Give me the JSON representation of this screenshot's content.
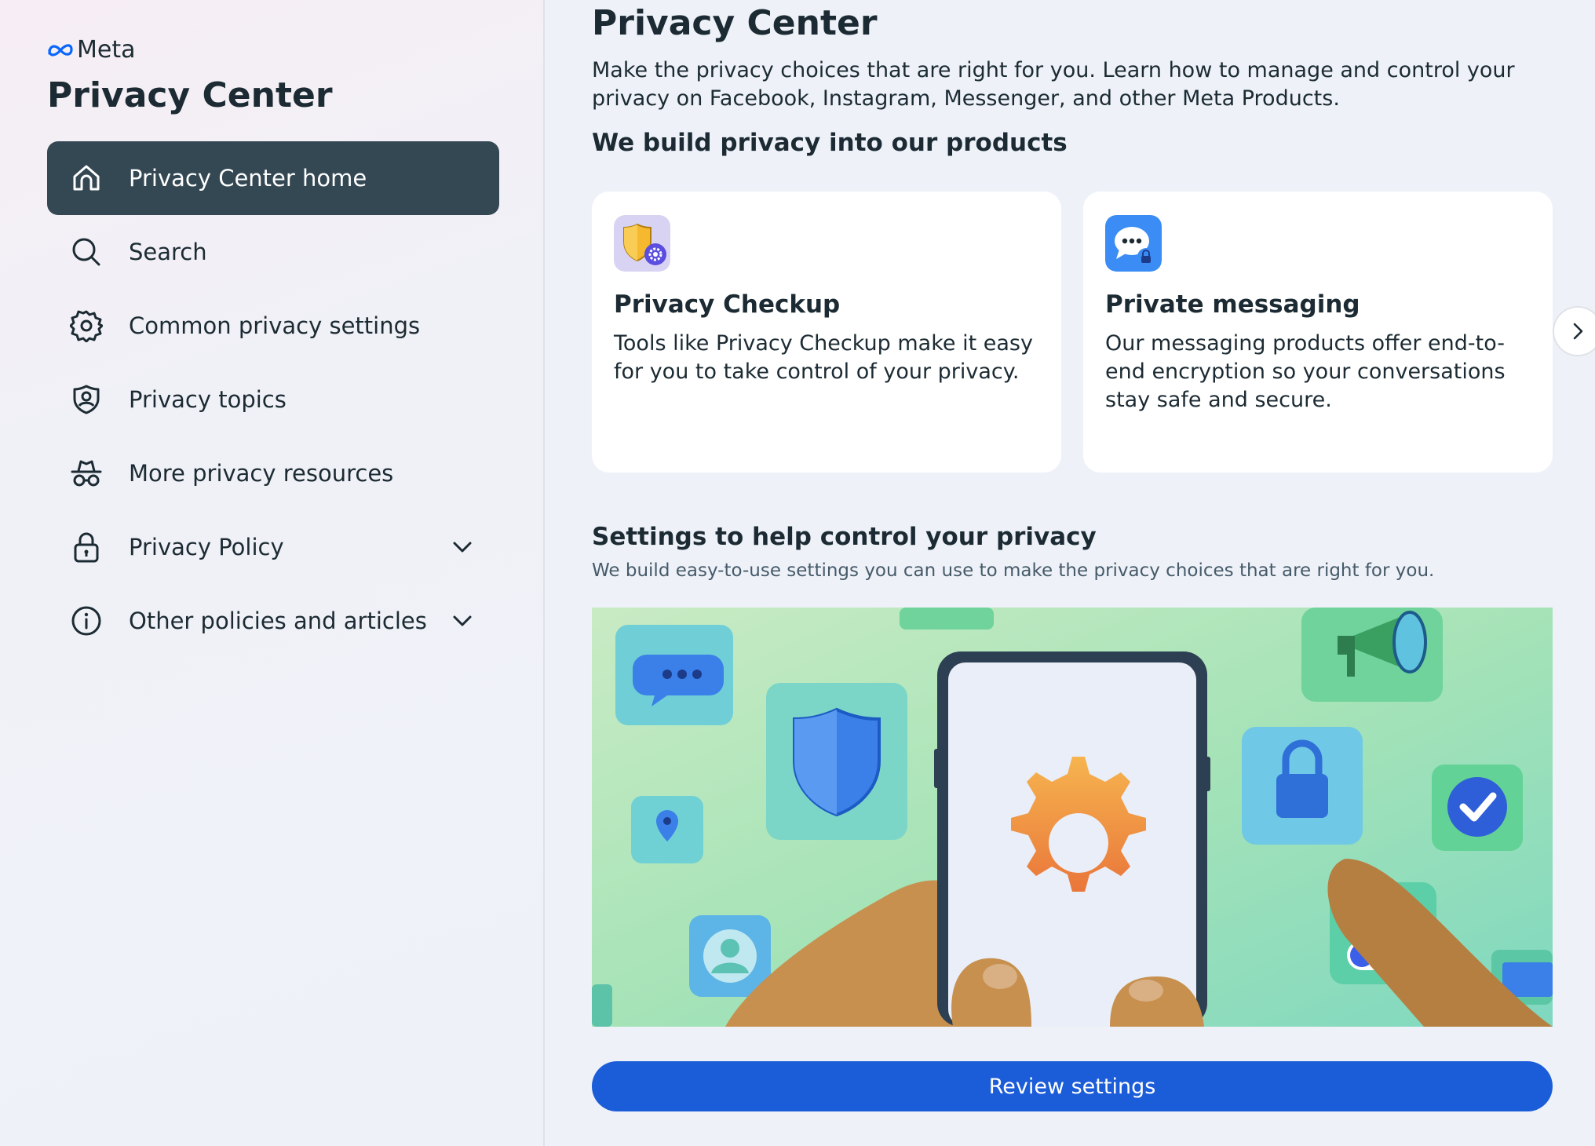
{
  "sidebar": {
    "brand": "Meta",
    "title": "Privacy Center",
    "items": [
      {
        "label": "Privacy Center home",
        "icon": "home-icon",
        "active": true
      },
      {
        "label": "Search",
        "icon": "search-icon"
      },
      {
        "label": "Common privacy settings",
        "icon": "gear-icon"
      },
      {
        "label": "Privacy topics",
        "icon": "shield-user-icon"
      },
      {
        "label": "More privacy resources",
        "icon": "incognito-icon"
      },
      {
        "label": "Privacy Policy",
        "icon": "lock-icon",
        "expandable": true
      },
      {
        "label": "Other policies and articles",
        "icon": "info-icon",
        "expandable": true
      }
    ]
  },
  "main": {
    "title": "Privacy Center",
    "intro": "Make the privacy choices that are right for you. Learn how to manage and control your privacy on Facebook, Instagram, Messenger, and other Meta Products.",
    "section1_title": "We build privacy into our products",
    "cards": [
      {
        "title": "Privacy Checkup",
        "desc": "Tools like Privacy Checkup make it easy for you to take control of your privacy.",
        "icon": "shield-gear-icon"
      },
      {
        "title": "Private messaging",
        "desc": "Our messaging products offer end-to-end encryption so your conversations stay safe and secure.",
        "icon": "chat-lock-icon"
      }
    ],
    "section2_title": "Settings to help control your privacy",
    "section2_desc": "We build easy-to-use settings you can use to make the privacy choices that are right for you.",
    "review_button": "Review settings"
  },
  "colors": {
    "active_nav": "#344854",
    "button_blue": "#1b5cd8",
    "text": "#1c2b33"
  }
}
